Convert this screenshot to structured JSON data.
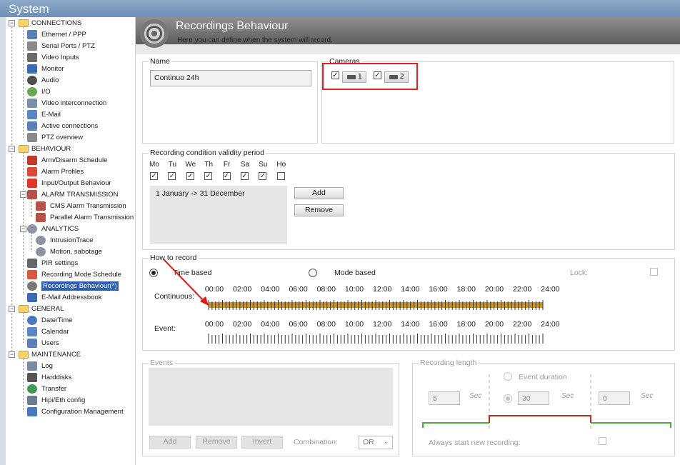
{
  "window": {
    "title": "System"
  },
  "tree": {
    "connections": {
      "label": "CONNECTIONS",
      "items": [
        "Ethernet / PPP",
        "Serial Ports / PTZ",
        "Video Inputs",
        "Monitor",
        "Audio",
        "I/O",
        "Video interconnection",
        "E-Mail",
        "Active connections",
        "PTZ overview"
      ]
    },
    "behaviour": {
      "label": "BEHAVIOUR",
      "items": [
        "Arm/Disarm Schedule",
        "Alarm Profiles",
        "Input/Output Behaviour"
      ],
      "alarm_transmission": {
        "label": "ALARM TRANSMISSION",
        "items": [
          "CMS Alarm Transmission",
          "Parallel Alarm Transmission"
        ]
      },
      "analytics": {
        "label": "ANALYTICS",
        "items": [
          "IntrusionTrace",
          "Motion, sabotage"
        ]
      },
      "items_after": [
        "PIR settings",
        "Recording Mode Schedule",
        "Recordings Behaviour(*)",
        "E-Mail Addressbook"
      ]
    },
    "general": {
      "label": "GENERAL",
      "items": [
        "Date/Time",
        "Calendar",
        "Users"
      ]
    },
    "maintenance": {
      "label": "MAINTENANCE",
      "items": [
        "Log",
        "Harddisks",
        "Transfer",
        "Hipi/Eth config",
        "Configuration Management"
      ]
    }
  },
  "header": {
    "title": "Recordings Behaviour",
    "subtitle": "Here you can define when the system will record."
  },
  "name_group": {
    "label": "Name",
    "value": "Continuo 24h"
  },
  "cameras_group": {
    "label": "Cameras",
    "cameras": [
      {
        "number": "1",
        "checked": true
      },
      {
        "number": "2",
        "checked": true
      }
    ],
    "highlight_color": "#e02020"
  },
  "validity": {
    "label": "Recording condition validity period",
    "days": [
      {
        "label": "Mo",
        "checked": true
      },
      {
        "label": "Tu",
        "checked": true
      },
      {
        "label": "We",
        "checked": true
      },
      {
        "label": "Th",
        "checked": true
      },
      {
        "label": "Fr",
        "checked": true
      },
      {
        "label": "Sa",
        "checked": true
      },
      {
        "label": "Su",
        "checked": true
      },
      {
        "label": "Ho",
        "checked": false
      }
    ],
    "periods": [
      "1 January -> 31 December"
    ],
    "add_label": "Add",
    "remove_label": "Remove"
  },
  "how": {
    "label": "How to record",
    "time_based": "Time based",
    "mode_based": "Mode based",
    "time_based_selected": true,
    "lock_label": "Lock:",
    "continuous_label": "Continuous:",
    "event_label": "Event:",
    "times": [
      "00:00",
      "02:00",
      "04:00",
      "06:00",
      "08:00",
      "10:00",
      "12:00",
      "14:00",
      "16:00",
      "18:00",
      "20:00",
      "22:00",
      "24:00"
    ],
    "continuous_active_fraction": 1.0,
    "continuous_color": "#c8952e",
    "event_active_fraction": 0.0
  },
  "events": {
    "label": "Events",
    "add_label": "Add",
    "remove_label": "Remove",
    "invert_label": "Invert",
    "combination_label": "Combination:",
    "combination_value": "OR"
  },
  "recording_length": {
    "label": "Recording length",
    "event_duration_label": "Event duration",
    "pre_value": "5",
    "event_value": "30",
    "post_value": "0",
    "unit": "Sec",
    "always_label": "Always start new recording:",
    "line_pre_color": "#4caf3a",
    "line_event_color": "#b03020"
  },
  "annotation_arrow_color": "#e01818"
}
